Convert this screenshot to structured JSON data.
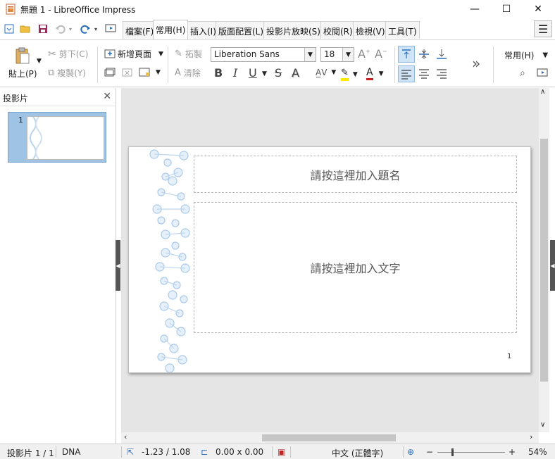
{
  "window": {
    "title": "無題 1 - LibreOffice Impress",
    "minimize_glyph": "—",
    "maximize_glyph": "☐",
    "close_glyph": "✕"
  },
  "tabs": [
    {
      "label": "檔案(F)"
    },
    {
      "label": "常用(H)",
      "active": true
    },
    {
      "label": "插入(I)"
    },
    {
      "label": "版面配置(L)"
    },
    {
      "label": "投影片放映(S)"
    },
    {
      "label": "校閱(R)"
    },
    {
      "label": "檢視(V)"
    },
    {
      "label": "工具(T)"
    }
  ],
  "ribbon": {
    "paste_label": "貼上(P)",
    "cut_label": "剪下(C)",
    "copy_label": "複製(Y)",
    "new_page_label": "新增頁面",
    "clone_label": "拓製",
    "clear_label": "清除",
    "font_name": "Liberation Sans",
    "font_size": "18",
    "style_label": "常用(H)",
    "bold_glyph": "B",
    "italic_glyph": "I",
    "underline_glyph": "U",
    "strike_glyph": "S",
    "shadow_glyph": "A",
    "more_glyph": "»"
  },
  "slides_panel": {
    "title": "投影片",
    "close_glyph": "✕",
    "thumbs": [
      {
        "number": "1"
      }
    ]
  },
  "slide": {
    "title_placeholder": "請按這裡加入題名",
    "content_placeholder": "請按這裡加入文字",
    "page_number": "1"
  },
  "statusbar": {
    "slide_position": "投影片 1 / 1",
    "master": "DNA",
    "cursor_pos": "-1.23 / 1.08",
    "size": "0.00 x 0.00",
    "language": "中文 (正體字)",
    "zoom_minus": "−",
    "zoom_plus": "+",
    "zoom": "54%"
  },
  "colors": {
    "accent_blue": "#2a6ebb",
    "dna_blue": "#b9d4ef",
    "thumb_selected": "#9fc3e4",
    "workspace_bg": "#e5e5e5"
  }
}
